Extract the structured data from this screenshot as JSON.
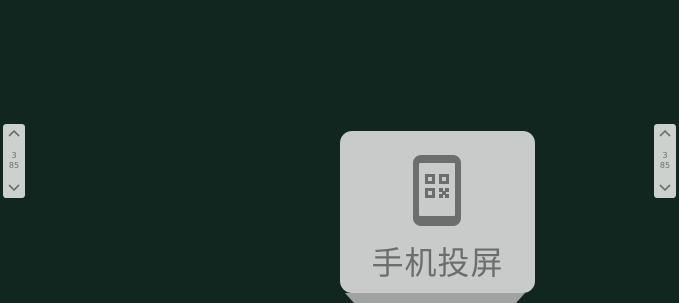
{
  "pager_left": {
    "up_icon": "chevron-up-icon",
    "down_icon": "chevron-down-icon",
    "value_top": "3",
    "value_bottom": "85"
  },
  "pager_right": {
    "up_icon": "chevron-up-icon",
    "down_icon": "chevron-down-icon",
    "value_top": "3",
    "value_bottom": "85"
  },
  "cast_tile": {
    "icon": "phone-qr-icon",
    "label": "手机投屏"
  },
  "colors": {
    "background": "#122620",
    "tile": "#c8cbc9",
    "tile_text": "#6b6e6c",
    "pager": "#cdd1ce"
  }
}
